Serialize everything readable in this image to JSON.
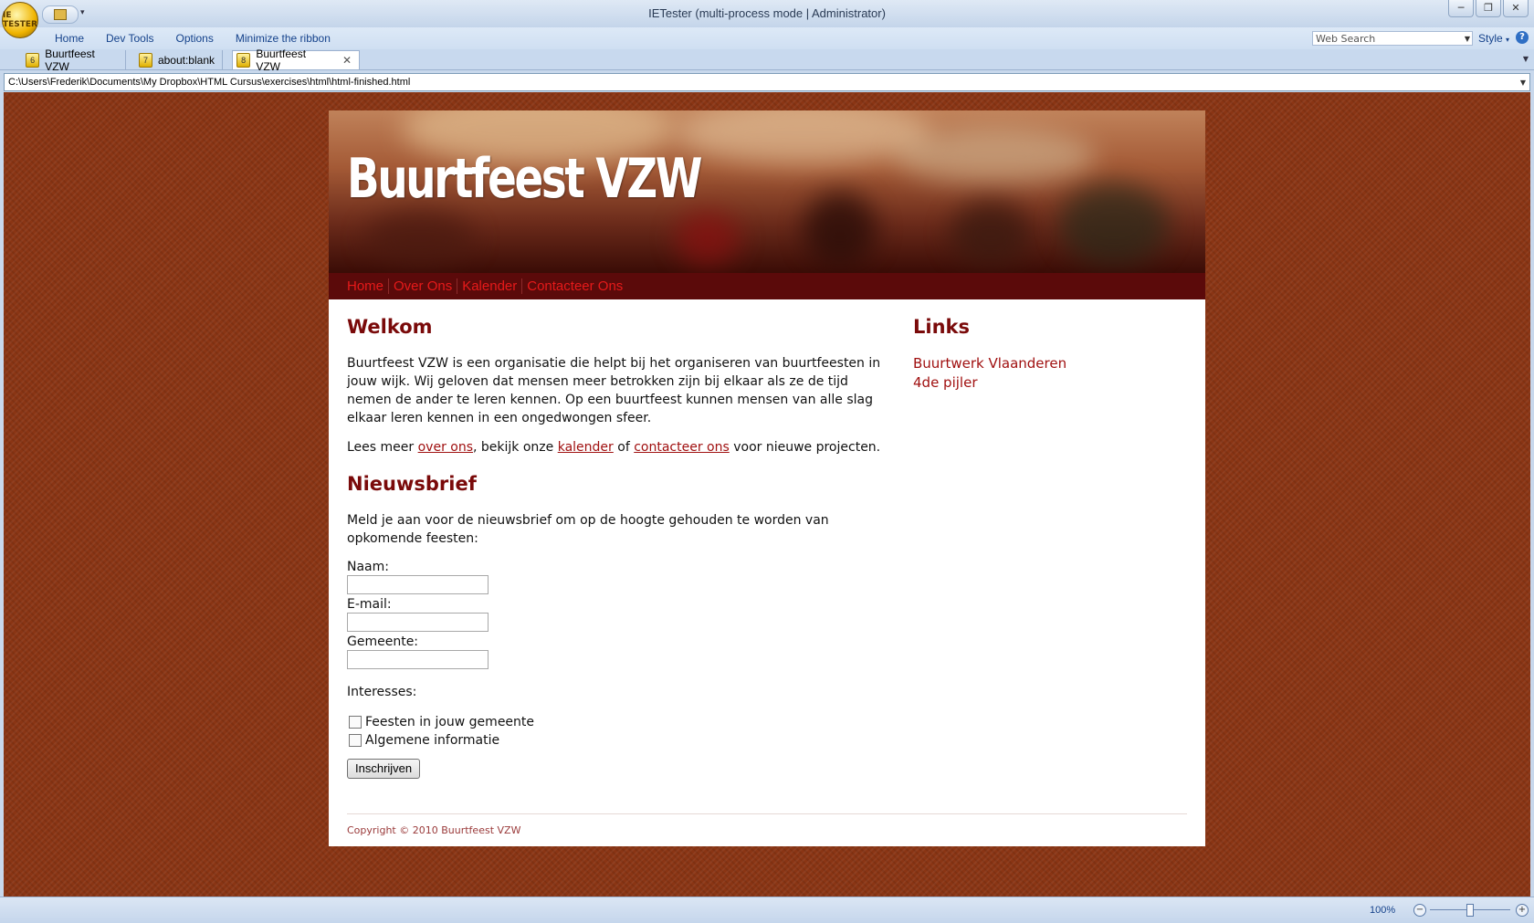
{
  "window": {
    "title": "IETester (multi-process mode | Administrator)",
    "logo_text": "IE TESTER",
    "minimize": "─",
    "maximize": "❐",
    "close": "✕"
  },
  "ribbon": {
    "menu": [
      "Home",
      "Dev Tools",
      "Options",
      "Minimize the ribbon"
    ],
    "search_placeholder": "Web Search",
    "style_label": "Style",
    "help": "?"
  },
  "tabs": [
    {
      "num": "6",
      "label": "Buurtfeest VZW",
      "active": false
    },
    {
      "num": "7",
      "label": "about:blank",
      "active": false
    },
    {
      "num": "8",
      "label": "Buurtfeest VZW",
      "active": true
    }
  ],
  "address": {
    "url": "C:\\Users\\Frederik\\Documents\\My Dropbox\\HTML Cursus\\exercises\\html\\html-finished.html"
  },
  "statusbar": {
    "zoom": "100%",
    "zoom_level_percent": 100
  },
  "site": {
    "banner_title": "Buurtfeest VZW",
    "nav": [
      "Home",
      "Over Ons",
      "Kalender",
      "Contacteer Ons"
    ],
    "welcome": {
      "heading": "Welkom",
      "intro": "Buurtfeest VZW is een organisatie die helpt bij het organiseren van buurtfeesten in jouw wijk. Wij geloven dat mensen meer betrokken zijn bij elkaar als ze de tijd nemen de ander te leren kennen. Op een buurtfeest kunnen mensen van alle slag elkaar leren kennen in een ongedwongen sfeer.",
      "more_prefix": "Lees meer ",
      "link_over": "over ons",
      "more_mid1": ", bekijk onze ",
      "link_kalender": "kalender",
      "more_mid2": " of ",
      "link_contact": "contacteer ons",
      "more_suffix": " voor nieuwe projecten."
    },
    "newsletter": {
      "heading": "Nieuwsbrief",
      "intro": "Meld je aan voor de nieuwsbrief om op de hoogte gehouden te worden van opkomende feesten:",
      "name_label": "Naam:",
      "email_label": "E-mail:",
      "city_label": "Gemeente:",
      "interests_label": "Interesses:",
      "checkbox1": "Feesten in jouw gemeente",
      "checkbox2": "Algemene informatie",
      "submit": "Inschrijven"
    },
    "links": {
      "heading": "Links",
      "items": [
        "Buurtwerk Vlaanderen",
        "4de pijler"
      ]
    },
    "copyright": "Copyright © 2010 Buurtfeest VZW"
  }
}
